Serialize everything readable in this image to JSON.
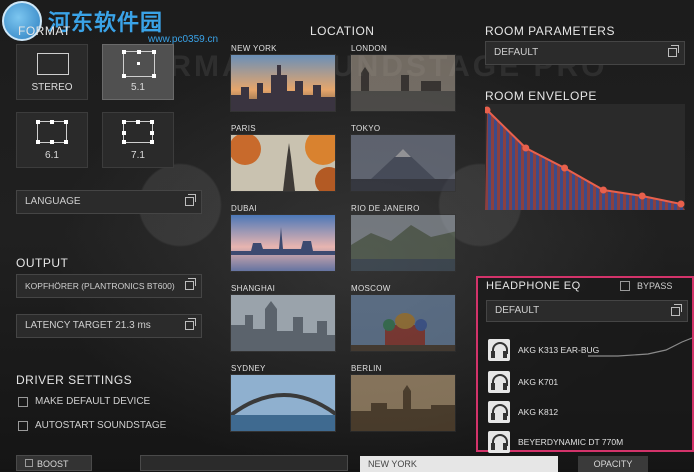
{
  "watermark": {
    "site": "河东软件园",
    "url": "www.pc0359.cn"
  },
  "brand_background": "HARMAN SOUNDSTAGE PRO",
  "format": {
    "title": "FORMAT",
    "options": [
      {
        "label": "STEREO",
        "selected": false
      },
      {
        "label": "5.1",
        "selected": true
      },
      {
        "label": "6.1",
        "selected": false
      },
      {
        "label": "7.1",
        "selected": false
      }
    ]
  },
  "language": {
    "value": "LANGUAGE"
  },
  "output": {
    "title": "OUTPUT",
    "device": "KOPFHÖRER (PLANTRONICS BT600)",
    "latency": "LATENCY TARGET 21.3 ms"
  },
  "driver_settings": {
    "title": "DRIVER SETTINGS",
    "make_default_device": "MAKE DEFAULT DEVICE",
    "autostart": "AUTOSTART SOUNDSTAGE"
  },
  "location": {
    "title": "LOCATION",
    "cities": [
      "NEW YORK",
      "LONDON",
      "PARIS",
      "TOKYO",
      "DUBAI",
      "RIO DE JANEIRO",
      "SHANGHAI",
      "MOSCOW",
      "SYDNEY",
      "BERLIN"
    ]
  },
  "room_parameters": {
    "title": "ROOM PARAMETERS",
    "preset": "DEFAULT"
  },
  "room_envelope": {
    "title": "ROOM ENVELOPE",
    "points": [
      1.0,
      0.62,
      0.42,
      0.2,
      0.14,
      0.06
    ],
    "line_color": "#e8604c"
  },
  "headphone_eq": {
    "title": "HEADPHONE EQ",
    "bypass_label": "BYPASS",
    "preset": "DEFAULT",
    "headphones": [
      "AKG K313 EAR-BUG",
      "AKG K701",
      "AKG K812",
      "BEYERDYNAMIC DT 770M"
    ],
    "highlight_color": "#d3336a"
  },
  "bottom": {
    "boost": "BOOST",
    "location_value": "NEW YORK",
    "opacity": "OPACITY"
  }
}
